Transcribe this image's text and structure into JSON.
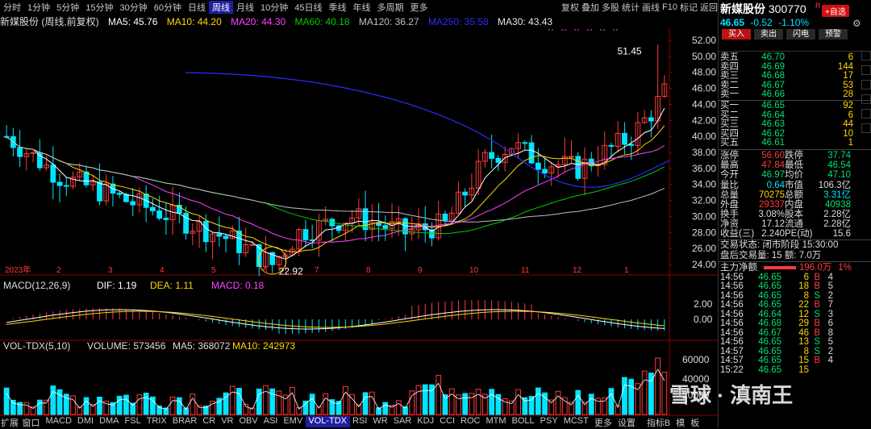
{
  "topbar": {
    "periods": [
      "分时",
      "1分钟",
      "5分钟",
      "15分钟",
      "30分钟",
      "60分钟",
      "日线",
      "周线",
      "月线",
      "10分钟",
      "45日线",
      "季线",
      "年线",
      "多周期",
      "更多"
    ],
    "selected": "周线",
    "right_items": [
      "复权",
      "叠加",
      "多股",
      "统计",
      "画线",
      "F10",
      "标记",
      "返回"
    ]
  },
  "ma_line": {
    "name": "新媒股份 (周线,前复权)",
    "ma5": "MA5: 45.76",
    "ma10": "MA10: 44.20",
    "ma20": "MA20: 44.30",
    "ma60": "MA60: 40.18",
    "ma120": "MA120: 36.27",
    "ma250": "MA250: 35.58",
    "ma30": "MA30: 43.43"
  },
  "colors": {
    "up": "#ff3b3b",
    "down": "#00e5ff",
    "ma5": "#ffffff",
    "ma10": "#ffd700",
    "ma20": "#ff40ff",
    "ma60": "#00cc00",
    "ma120": "#c0c0c0",
    "ma250": "#2b2bff",
    "ma30": "#e6e6e6"
  },
  "price_axis": {
    "ticks": [
      "52.00",
      "50.00",
      "48.00",
      "46.00",
      "44.00",
      "42.00",
      "40.00",
      "38.00",
      "36.00",
      "34.00",
      "32.00",
      "30.00",
      "28.00",
      "26.00",
      "24.00"
    ]
  },
  "chart_annotations": {
    "high": "51.45",
    "low": "22.92"
  },
  "x_axis": {
    "labels": [
      "2023年",
      "2",
      "3",
      "4",
      "5",
      "6",
      "7",
      "8",
      "9",
      "10",
      "11",
      "12",
      "1"
    ]
  },
  "macd": {
    "title": "MACD(12,26,9)",
    "dif": "DIF: 1.19",
    "dea": "DEA: 1.11",
    "macd": "MACD: 0.18",
    "ticks": [
      "2.00",
      "0.00"
    ]
  },
  "volume": {
    "title": "VOL-TDX(5,10)",
    "volume": "VOLUME: 573456",
    "ma5": "MA5: 368072",
    "ma10": "MA10: 242973",
    "ticks": [
      "60000",
      "40000",
      "20000"
    ]
  },
  "bottombar": {
    "items": [
      "窗口",
      "MACD",
      "DMI",
      "DMA",
      "FSL",
      "TRIX",
      "BRAR",
      "CR",
      "VR",
      "OBV",
      "ASI",
      "EMV",
      "VOL-TDX",
      "RSI",
      "WR",
      "SAR",
      "KDJ",
      "CCI",
      "ROC",
      "MTM",
      "BOLL",
      "PSY",
      "MCST",
      "更多",
      "设置"
    ],
    "selected": "VOL-TDX",
    "left_label": "扩展",
    "right_items": [
      "指标B",
      "模",
      "板"
    ]
  },
  "quote": {
    "stock_name": "新媒股份",
    "stock_code": "300770",
    "price": "46.65",
    "change": "-0.52",
    "pct": "-1.10%",
    "r_badge": "R",
    "add_button": "+自选",
    "buy_btn": "买入",
    "sell_btn": "卖出",
    "flash_btn": "闪电",
    "warn_btn": "预警",
    "asks": [
      {
        "label": "卖五",
        "price": "46.70",
        "vol": "6"
      },
      {
        "label": "卖四",
        "price": "46.69",
        "vol": "144"
      },
      {
        "label": "卖三",
        "price": "46.68",
        "vol": "17"
      },
      {
        "label": "卖二",
        "price": "46.67",
        "vol": "53"
      },
      {
        "label": "卖一",
        "price": "46.66",
        "vol": "28"
      }
    ],
    "bids": [
      {
        "label": "买一",
        "price": "46.65",
        "vol": "92"
      },
      {
        "label": "买二",
        "price": "46.64",
        "vol": "6"
      },
      {
        "label": "买三",
        "price": "46.63",
        "vol": "44"
      },
      {
        "label": "买四",
        "price": "46.62",
        "vol": "10"
      },
      {
        "label": "买五",
        "price": "46.61",
        "vol": "1"
      }
    ],
    "stats": [
      [
        "涨停",
        "56.60",
        "跌停",
        "37.74"
      ],
      [
        "最高",
        "47.84",
        "最低",
        "46.54"
      ],
      [
        "今开",
        "46.97",
        "均价",
        "47.10"
      ],
      [
        "量比",
        "0.64",
        "市值",
        "106.3亿"
      ],
      [
        "总量",
        "70275",
        "总额",
        "3.31亿"
      ],
      [
        "外盘",
        "29337",
        "内盘",
        "40938"
      ],
      [
        "换手",
        "3.08%",
        "股本",
        "2.28亿"
      ],
      [
        "净资",
        "17.12",
        "流通",
        "2.28亿"
      ],
      [
        "收益(三)",
        "2.240",
        "PE(动)",
        "15.6"
      ]
    ],
    "status": "交易状态: 闭市阶段 15:30:00",
    "after": "盘后交易量: 15 额: 7.0万",
    "net_label": "主力净额",
    "net_value": "196.0万",
    "net_pct": "1%",
    "ticks": [
      [
        "14:56",
        "46.65",
        "6",
        "B",
        "4"
      ],
      [
        "14:56",
        "46.65",
        "18",
        "B",
        "5"
      ],
      [
        "14:56",
        "46.65",
        "8",
        "S",
        "2"
      ],
      [
        "14:56",
        "46.65",
        "22",
        "B",
        "7"
      ],
      [
        "14:56",
        "46.64",
        "12",
        "S",
        "3"
      ],
      [
        "14:56",
        "46.68",
        "29",
        "B",
        "6"
      ],
      [
        "14:56",
        "46.67",
        "46",
        "B",
        "8"
      ],
      [
        "14:56",
        "46.65",
        "13",
        "S",
        "5"
      ],
      [
        "14:57",
        "46.65",
        "8",
        "S",
        "2"
      ],
      [
        "14:57",
        "46.65",
        "15",
        "B",
        "4"
      ],
      [
        "15:22",
        "46.65",
        "15",
        "",
        ""
      ]
    ]
  },
  "watermark": "雪球 · 滇南王"
}
